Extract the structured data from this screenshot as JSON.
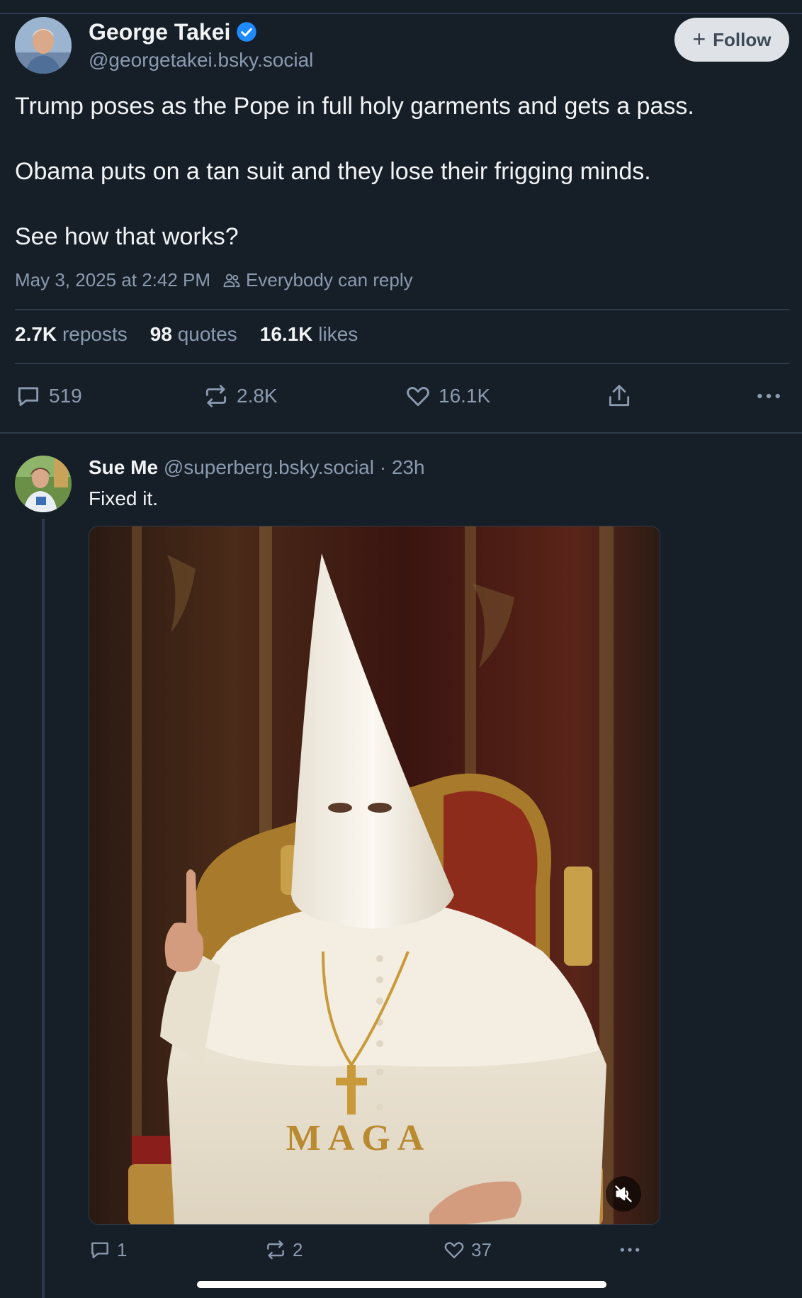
{
  "post": {
    "author_name": "George Takei",
    "author_handle": "@georgetakei.bsky.social",
    "follow_label": "Follow",
    "text": [
      "Trump poses as the Pope in full holy garments and gets a pass.",
      "Obama puts on a tan suit and they lose their frigging minds.",
      "See how that works?"
    ],
    "timestamp": "May 3, 2025 at 2:42 PM",
    "reply_setting": "Everybody can reply",
    "stats": {
      "reposts_value": "2.7K",
      "reposts_label": "reposts",
      "quotes_value": "98",
      "quotes_label": "quotes",
      "likes_value": "16.1K",
      "likes_label": "likes"
    },
    "actions": {
      "replies": "519",
      "reposts": "2.8K",
      "likes": "16.1K"
    }
  },
  "reply": {
    "author_name": "Sue Me",
    "author_handle": "@superberg.bsky.social",
    "time_ago": "· 23h",
    "text": "Fixed it.",
    "media_text": "MAGA",
    "actions": {
      "replies": "1",
      "reposts": "2",
      "likes": "37"
    }
  },
  "colors": {
    "background": "#161e27",
    "muted": "#8a9bb0",
    "verified": "#208bfe",
    "divider": "#2c3a4b"
  }
}
